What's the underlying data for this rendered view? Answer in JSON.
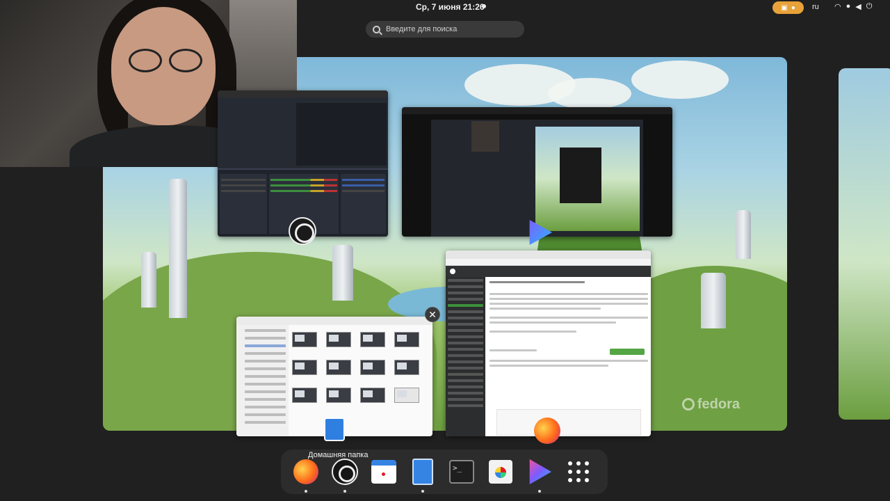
{
  "topbar": {
    "clock": "Ср, 7 июня  21:26",
    "language": "ru"
  },
  "search": {
    "placeholder": "Введите для поиска"
  },
  "dock": {
    "tooltip": "Домашняя папка",
    "items": [
      {
        "name": "firefox",
        "icon": "firefox-icon",
        "running": true
      },
      {
        "name": "obs-studio",
        "icon": "obs-icon",
        "running": true
      },
      {
        "name": "calendar",
        "icon": "calendar-icon",
        "running": false
      },
      {
        "name": "files",
        "icon": "files-icon",
        "running": true
      },
      {
        "name": "terminal",
        "icon": "terminal-icon",
        "running": false
      },
      {
        "name": "software",
        "icon": "software-icon",
        "running": false
      },
      {
        "name": "screen-recorder",
        "icon": "recorder-icon",
        "running": true
      },
      {
        "name": "show-apps",
        "icon": "app-grid-icon",
        "running": false
      }
    ]
  },
  "wallpaper": {
    "watermark": "fedora"
  },
  "colors": {
    "accent": "#e8a23a",
    "dock_bg": "#2c2c2c",
    "files_blue": "#3584e4"
  }
}
